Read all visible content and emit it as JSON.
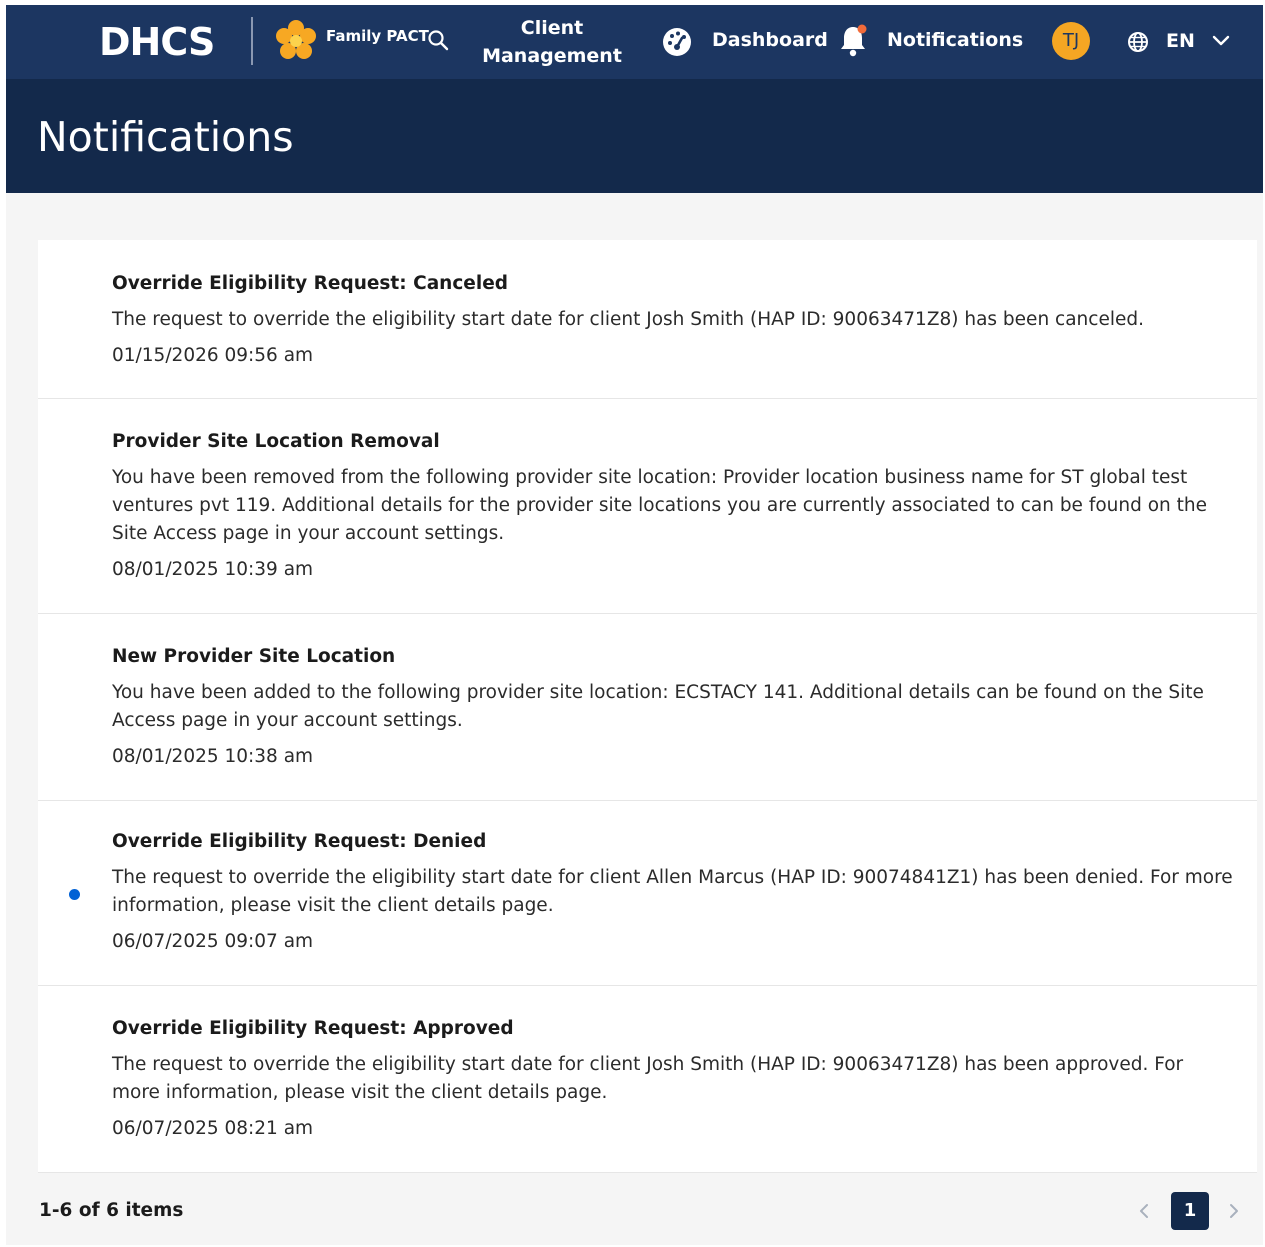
{
  "nav": {
    "logo_text": "DHCS",
    "program_label": "Family PACT",
    "client_line1": "Client",
    "client_line2": "Management",
    "dashboard_label": "Dashboard",
    "notifications_label": "Notifications",
    "avatar_initials": "TJ",
    "language": "EN",
    "icons": [
      "family-pact-flower-icon",
      "search-icon",
      "dashboard-gauge-icon",
      "bell-icon",
      "globe-icon",
      "chevron-down-icon"
    ],
    "colors": {
      "nav_bg": "#1c3661",
      "header_bg": "#13294b",
      "avatar_bg": "#f5a623",
      "bell_dot": "#f26b3a",
      "flower": "#f7a823"
    }
  },
  "page": {
    "title": "Notifications"
  },
  "notifications": [
    {
      "title": "Override Eligibility Request: Canceled",
      "body": "The request to override the eligibility start date for client Josh Smith (HAP ID: 90063471Z8) has been canceled.",
      "date": "01/15/2026 09:56 am",
      "unread": false
    },
    {
      "title": "Provider Site Location Removal",
      "body": "You have been removed from the following provider site location: Provider location business name for ST global test ventures pvt 119. Additional details for the provider site locations you are currently associated to can be found on the Site Access page in your account settings.",
      "date": "08/01/2025 10:39 am",
      "unread": false
    },
    {
      "title": "New Provider Site Location",
      "body": "You have been added to the following provider site location: ECSTACY 141. Additional details can be found on the Site Access page in your account settings.",
      "date": "08/01/2025 10:38 am",
      "unread": false
    },
    {
      "title": "Override Eligibility Request: Denied",
      "body": "The request to override the eligibility start date for client Allen Marcus (HAP ID: 90074841Z1) has been denied. For more information, please visit the client details page.",
      "date": "06/07/2025 09:07 am",
      "unread": true
    },
    {
      "title": "Override Eligibility Request: Approved",
      "body": "The request to override the eligibility start date for client Josh Smith (HAP ID: 90063471Z8) has been approved. For more information, please visit the client details page.",
      "date": "06/07/2025 08:21 am",
      "unread": false
    }
  ],
  "pagination": {
    "summary": "1-6 of 6 items",
    "current_page": "1",
    "icons": [
      "chevron-left-icon",
      "chevron-right-icon"
    ]
  }
}
